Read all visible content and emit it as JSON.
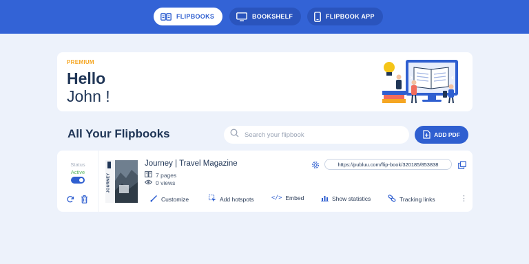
{
  "nav": {
    "flipbooks": "FLIPBOOKS",
    "bookshelf": "BOOKSHELF",
    "flipbook_app": "FLIPBOOK APP"
  },
  "greeting": {
    "plan": "PREMIUM",
    "hello": "Hello",
    "name": "John !"
  },
  "section_title": "All Your Flipbooks",
  "search": {
    "placeholder": "Search your flipbook"
  },
  "add_pdf": "ADD PDF",
  "flipbook": {
    "status_label": "Status",
    "status_value": "Active",
    "title": "Journey | Travel Magazine",
    "pages": "7 pages",
    "views": "0 views",
    "url": "https://publuu.com/flip-book/320185/853838",
    "cover_text": "JOURNEY",
    "actions": {
      "customize": "Customize",
      "add_hotspots": "Add hotspots",
      "embed": "Embed",
      "show_statistics": "Show statistics",
      "tracking_links": "Tracking links"
    }
  },
  "colors": {
    "brand_blue": "#3363d6",
    "accent_orange": "#f5a623",
    "active_green": "#58b560",
    "background": "#edf2fb"
  }
}
